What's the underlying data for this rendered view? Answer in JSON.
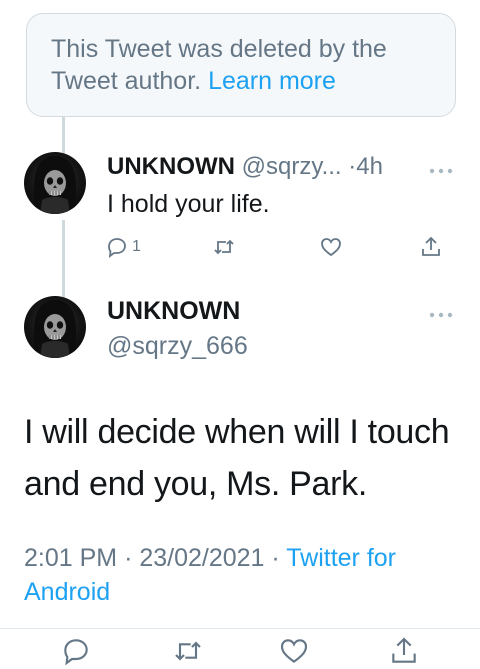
{
  "deleted_notice": {
    "text": "This Tweet was deleted by the Tweet author.",
    "link": "Learn more"
  },
  "reply_tweet": {
    "display_name": "UNKNOWN",
    "handle": "@sqrzy...",
    "separator": "·",
    "time": "4h",
    "text": "I hold your life.",
    "reply_count": "1",
    "icons": [
      "reply-icon",
      "retweet-icon",
      "like-icon",
      "share-icon",
      "more-icon"
    ]
  },
  "main_tweet": {
    "display_name": "UNKNOWN",
    "handle": "@sqrzy_666",
    "text": "I will decide when will I touch and end you, Ms. Park.",
    "time": "2:01 PM",
    "date": "23/02/2021",
    "separator": "·",
    "via": "Twitter for Android",
    "icons": [
      "reply-icon",
      "retweet-icon",
      "like-icon",
      "share-icon",
      "more-icon"
    ]
  },
  "colors": {
    "link": "#1da1f2",
    "muted": "#657786",
    "text": "#14171a",
    "border": "#d3dbe0",
    "background_notice": "#f5f8fa"
  }
}
